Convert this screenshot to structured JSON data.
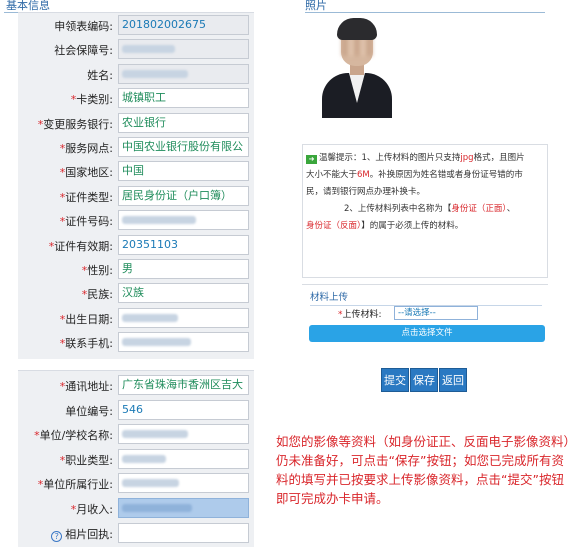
{
  "basic_section": {
    "title": "基本信息",
    "rows_group1": [
      {
        "label": "申领表编码:",
        "required": false,
        "value": "201802002675",
        "style": "grey"
      },
      {
        "label": "社会保障号:",
        "required": false,
        "value": "",
        "style": "grey blur"
      },
      {
        "label": "姓名:",
        "required": false,
        "value": "",
        "style": "grey blur"
      },
      {
        "label": "卡类别:",
        "required": true,
        "value": "城镇职工",
        "style": "green"
      },
      {
        "label": "变更服务银行:",
        "required": true,
        "value": "农业银行",
        "style": "green"
      },
      {
        "label": "服务网点:",
        "required": true,
        "value": "中国农业银行股份有限公",
        "style": "green"
      },
      {
        "label": "国家地区:",
        "required": true,
        "value": "中国",
        "style": "green"
      },
      {
        "label": "证件类型:",
        "required": true,
        "value": "居民身份证（户口簿）",
        "style": "green"
      },
      {
        "label": "证件号码:",
        "required": true,
        "value": "",
        "style": "blur"
      },
      {
        "label": "证件有效期:",
        "required": true,
        "value": "20351103",
        "style": ""
      },
      {
        "label": "性别:",
        "required": true,
        "value": "男",
        "style": "green"
      },
      {
        "label": "民族:",
        "required": true,
        "value": "汉族",
        "style": "green"
      },
      {
        "label": "出生日期:",
        "required": true,
        "value": "",
        "style": "blur"
      },
      {
        "label": "联系手机:",
        "required": true,
        "value": "",
        "style": "blur"
      }
    ],
    "rows_group2": [
      {
        "label": "通讯地址:",
        "required": true,
        "value": "广东省珠海市香洲区吉大",
        "style": "green"
      },
      {
        "label": "单位编号:",
        "required": false,
        "value": "546",
        "style": ""
      },
      {
        "label": "单位/学校名称:",
        "required": true,
        "value": "",
        "style": "blur"
      },
      {
        "label": "职业类型:",
        "required": true,
        "value": "",
        "style": "blur"
      },
      {
        "label": "单位所属行业:",
        "required": true,
        "value": "",
        "style": "blur"
      },
      {
        "label": "月收入:",
        "required": true,
        "value": "",
        "style": "bluefill"
      },
      {
        "label": "相片回执:",
        "required": false,
        "value": "",
        "style": "help"
      }
    ]
  },
  "photo_section": {
    "title": "照片"
  },
  "tips": {
    "line1_prefix": "温馨提示：1、上传材料的图片只支持",
    "line1_fmt": "jpg",
    "line1_suffix": "格式，且图片",
    "line2_prefix": "大小不能大于",
    "line2_size": "6M",
    "line2_suffix": "。补换原因为姓名错或者身份证号错的市",
    "line3": "民，请到银行网点办理补换卡。",
    "line4_prefix": "2、上传材料列表中名称为【",
    "line4_hl": "身份证（正面）",
    "line4_suffix": "、",
    "line5_hl": "身份证（反面）",
    "line5_suffix": "】的属于必须上传的材料。"
  },
  "upload": {
    "title": "材料上传",
    "label": "上传材料:",
    "select_value": "--请选择--",
    "button_label": "点击选择文件"
  },
  "actions": {
    "submit": "提交",
    "save": "保存",
    "back": "返回"
  },
  "note": "如您的影像等资料（如身份证正、反面电子影像资料）仍未准备好，可点击“保存”按钮；如您已完成所有资料的填写并已按要求上传影像资料，点击“提交”按钮即可完成办卡申请。",
  "colors": {
    "label_required": "#d9262b",
    "field_text": "#1b7ab6",
    "button_blue": "#2a79c2",
    "note_red": "#d9262b"
  }
}
